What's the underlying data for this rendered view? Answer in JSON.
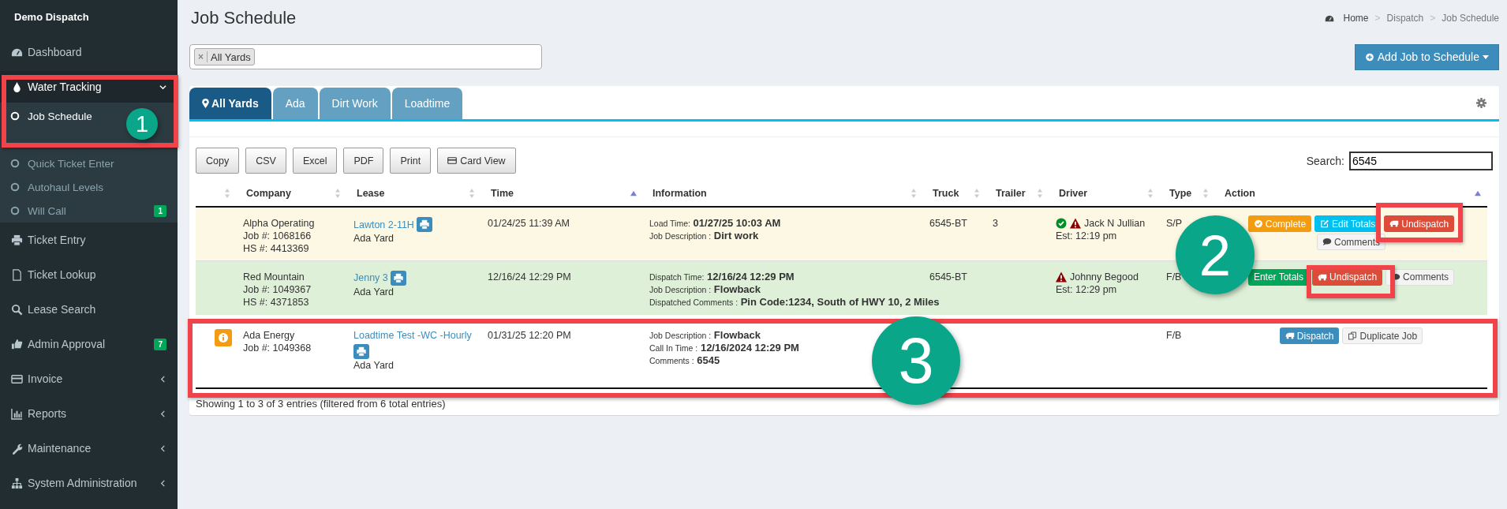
{
  "sidebar": {
    "brand": "Demo Dispatch",
    "items": [
      {
        "label": "Dashboard",
        "expanded": false
      },
      {
        "label": "Water Tracking",
        "expanded": true,
        "children": [
          {
            "label": "Job Schedule",
            "selected": true
          },
          {
            "label": "Quick Ticket Enter",
            "selected": false
          },
          {
            "label": "Autohaul Levels",
            "selected": false
          },
          {
            "label": "Will Call",
            "selected": false,
            "badge": "1"
          }
        ]
      },
      {
        "label": "Ticket Entry",
        "expanded": false
      },
      {
        "label": "Ticket Lookup",
        "expanded": false
      },
      {
        "label": "Lease Search",
        "expanded": false
      },
      {
        "label": "Admin Approval",
        "expanded": false,
        "badge": "7"
      },
      {
        "label": "Invoice",
        "expanded": false,
        "has_children": true
      },
      {
        "label": "Reports",
        "expanded": false,
        "has_children": true
      },
      {
        "label": "Maintenance",
        "expanded": false,
        "has_children": true
      },
      {
        "label": "System Administration",
        "expanded": false,
        "has_children": true
      }
    ]
  },
  "page_title": "Job Schedule",
  "breadcrumb": {
    "separator": ">",
    "items": [
      "Home",
      "Dispatch",
      "Job Schedule"
    ]
  },
  "yard_filter": {
    "tags": [
      {
        "remove": "×",
        "label": "All Yards"
      }
    ]
  },
  "add_button": "Add Job to Schedule",
  "tabs": [
    {
      "label": "All Yards",
      "selected": true
    },
    {
      "label": "Ada",
      "selected": false
    },
    {
      "label": "Dirt Work",
      "selected": false
    },
    {
      "label": "Loadtime",
      "selected": false
    }
  ],
  "export_buttons": [
    "Copy",
    "CSV",
    "Excel",
    "PDF",
    "Print",
    "Card View"
  ],
  "search": {
    "label": "Search:",
    "value": "6545"
  },
  "table": {
    "columns": [
      {
        "sorted": false
      },
      {
        "label": "Company",
        "sorted": false
      },
      {
        "label": "Lease",
        "sorted": false
      },
      {
        "label": "Time",
        "sorted": true
      },
      {
        "label": "Information",
        "sorted": false
      },
      {
        "label": "Truck",
        "sorted": false
      },
      {
        "label": "Trailer",
        "sorted": false
      },
      {
        "label": "Driver",
        "sorted": false
      },
      {
        "label": "Type",
        "sorted": false
      },
      {
        "label": "Action",
        "sorted": true
      }
    ],
    "rows": [
      {
        "color": "#fcf8e3",
        "flag": false,
        "company": [
          "Alpha Operating",
          "Job #: 1068166",
          "HS #: 4413369"
        ],
        "lease": "Lawton 2-11H",
        "lease_print_wrap": false,
        "yard": "Ada Yard",
        "time": "01/24/25 11:39 AM",
        "info": [
          {
            "label": "Load Time:",
            "value": "01/27/25 10:03 AM"
          },
          {
            "label": "Job Description :",
            "value": "Dirt work"
          }
        ],
        "truck": "6545-BT",
        "trailer": "3",
        "driver": {
          "name": "Jack N Jullian",
          "checked": true,
          "warning": true,
          "est": "Est: 12:19 pm"
        },
        "type": "S/P",
        "actions": [
          {
            "kind": "complete",
            "label": "Complete"
          },
          {
            "kind": "edit",
            "label": "Edit Totals"
          },
          {
            "kind": "undispatch",
            "label": "Undispatch"
          },
          {
            "kind": "comments",
            "label": "Comments"
          }
        ]
      },
      {
        "color": "#dff0d8",
        "flag": false,
        "company": [
          "Red Mountain",
          "Job #: 1049367",
          "HS #: 4371853"
        ],
        "lease": "Jenny 3",
        "lease_print_wrap": false,
        "yard": "Ada Yard",
        "time": "12/16/24 12:29 PM",
        "info": [
          {
            "label": "Dispatch Time:",
            "value": "12/16/24 12:29 PM"
          },
          {
            "label": "Job Description :",
            "value": "Flowback"
          },
          {
            "label": "Dispatched Comments :",
            "value": "Pin Code:1234, South of HWY 10, 2 Miles"
          }
        ],
        "truck": "6545-BT",
        "trailer": "",
        "driver": {
          "name": "Johnny Begood",
          "checked": false,
          "warning": true,
          "est": "Est: 12:29 pm"
        },
        "type": "F/B",
        "actions": [
          {
            "kind": "enter",
            "label": "Enter Totals"
          },
          {
            "kind": "undispatch",
            "label": "Undispatch"
          },
          {
            "kind": "comments",
            "label": "Comments"
          }
        ]
      },
      {
        "color": "#ffffff",
        "flag": true,
        "company": [
          "Ada Energy",
          "Job #: 1049368"
        ],
        "lease": "Loadtime Test -WC -Hourly",
        "lease_print_wrap": true,
        "yard": "Ada Yard",
        "time": "01/31/25 12:20 PM",
        "info": [
          {
            "label": "Job Description :",
            "value": "Flowback"
          },
          {
            "label": "Call In Time :",
            "value": "12/16/2024 12:29 PM"
          },
          {
            "label": "Comments :",
            "value": "6545"
          }
        ],
        "truck": "",
        "trailer": "",
        "driver": null,
        "type": "F/B",
        "actions": [
          {
            "kind": "dispatch",
            "label": "Dispatch"
          },
          {
            "kind": "duplicate",
            "label": "Duplicate Job"
          }
        ]
      }
    ]
  },
  "table_info": "Showing 1 to 3 of 3 entries (filtered from 6 total entries)",
  "annotations": [
    {
      "label": "1"
    },
    {
      "label": "2"
    },
    {
      "label": "3"
    }
  ]
}
